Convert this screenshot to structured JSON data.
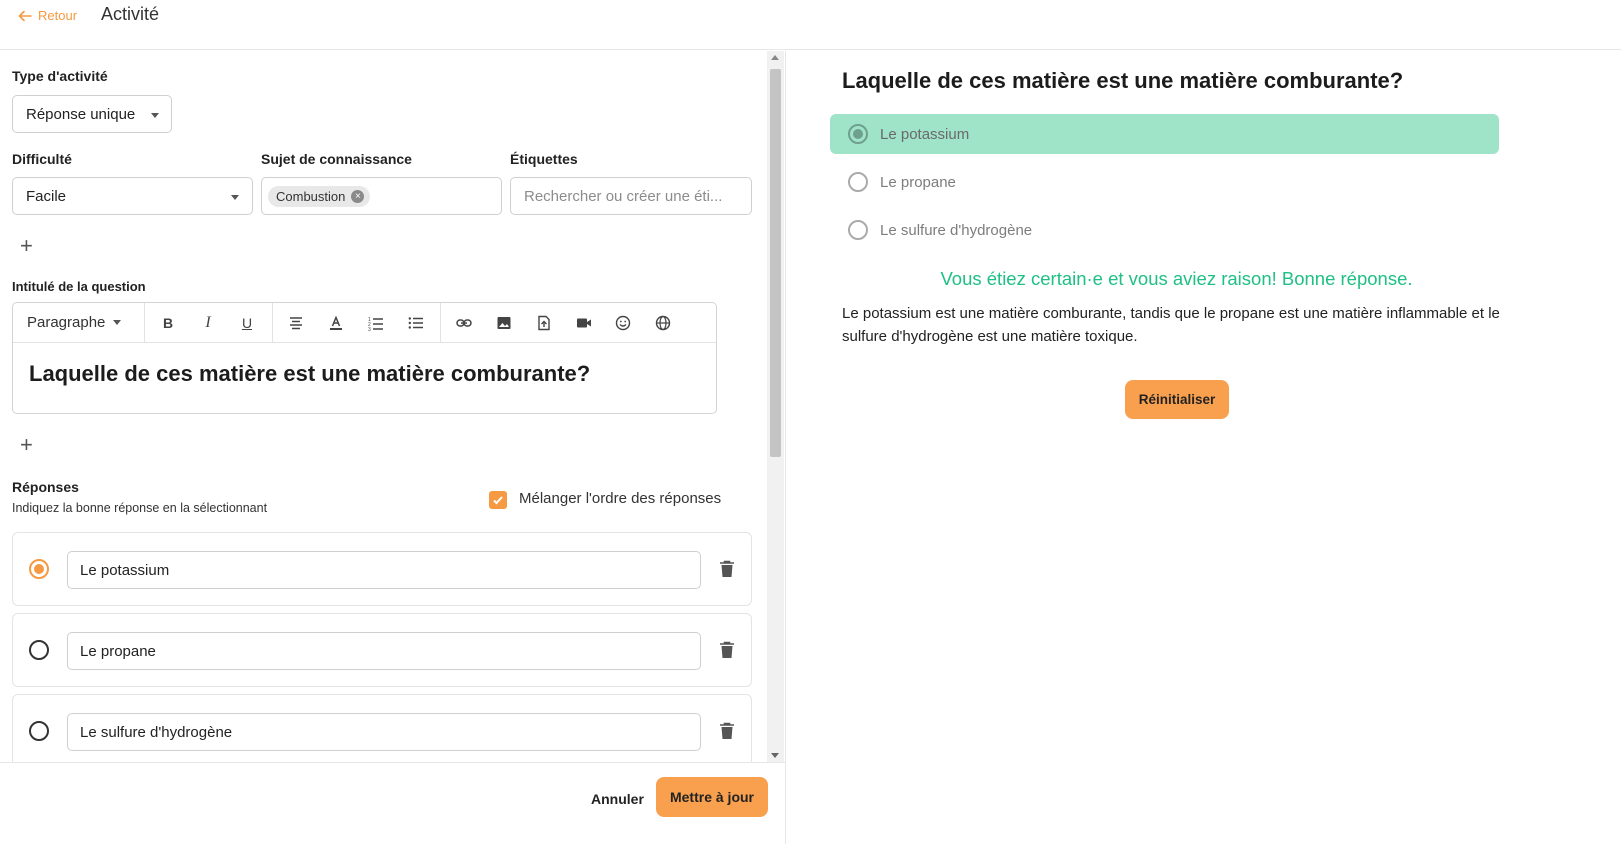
{
  "header": {
    "back_label": "Retour",
    "title": "Activité"
  },
  "activity_type": {
    "label": "Type d'activité",
    "value": "Réponse unique"
  },
  "difficulty": {
    "label": "Difficulté",
    "value": "Facile"
  },
  "knowledge_subject": {
    "label": "Sujet de connaissance",
    "chip": "Combustion"
  },
  "tags": {
    "label": "Étiquettes",
    "placeholder": "Rechercher ou créer une éti..."
  },
  "question": {
    "label": "Intitulé de la question",
    "format": "Paragraphe",
    "text": "Laquelle de ces matière est une matière comburante?"
  },
  "toolbar_icons": [
    "bold-icon",
    "italic-icon",
    "underline-icon",
    "align-center-icon",
    "text-color-icon",
    "ordered-list-icon",
    "bullet-list-icon",
    "link-icon",
    "image-icon",
    "file-upload-icon",
    "video-icon",
    "emoji-icon",
    "globe-icon"
  ],
  "answers": {
    "label": "Réponses",
    "hint": "Indiquez la bonne réponse en la sélectionnant",
    "shuffle_label": "Mélanger l'ordre des réponses",
    "shuffle_checked": true,
    "items": [
      {
        "text": "Le potassium",
        "selected": true
      },
      {
        "text": "Le propane",
        "selected": false
      },
      {
        "text": "Le sulfure d'hydrogène",
        "selected": false
      }
    ]
  },
  "footer": {
    "cancel_label": "Annuler",
    "submit_label": "Mettre à jour"
  },
  "preview": {
    "question": "Laquelle de ces matière est une matière comburante?",
    "options": [
      {
        "text": "Le potassium",
        "correct": true
      },
      {
        "text": "Le propane",
        "correct": false
      },
      {
        "text": "Le sulfure d'hydrogène",
        "correct": false
      }
    ],
    "feedback": "Vous étiez certain·e et vous aviez raison! Bonne réponse.",
    "explanation": "Le potassium est une matière comburante, tandis que le propane est une matière inflammable et le sulfure d'hydrogène est une matière toxique.",
    "reset_label": "Réinitialiser"
  },
  "colors": {
    "accent": "#f59a42",
    "button": "#f9a04e",
    "correct_bg": "#9fe3c8",
    "feedback": "#1fbf85"
  }
}
